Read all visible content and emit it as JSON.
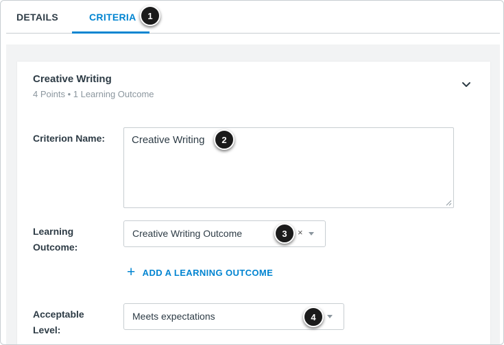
{
  "tabs": {
    "details": "DETAILS",
    "criteria": "CRITERIA"
  },
  "callouts": [
    "1",
    "2",
    "3",
    "4"
  ],
  "card": {
    "title": "Creative Writing",
    "subtitle": "4 Points • 1 Learning Outcome"
  },
  "form": {
    "criterion_name_label": "Criterion Name:",
    "criterion_name_value": "Creative Writing",
    "learning_outcome_label_1": "Learning",
    "learning_outcome_label_2": "Outcome:",
    "learning_outcome_value": "Creative Writing Outcome",
    "clear_glyph": "×",
    "add_outcome_label": "ADD A LEARNING OUTCOME",
    "plus_glyph": "+",
    "acceptable_level_label_1": "Acceptable",
    "acceptable_level_label_2": "Level:",
    "acceptable_level_value": "Meets expectations"
  },
  "icons": {
    "collapse": "chevron-down-icon",
    "dropdown": "caret-down-icon",
    "clear": "close-icon",
    "add": "plus-icon"
  },
  "colors": {
    "accent": "#0084d1",
    "text": "#2d3b45",
    "muted": "#8b969e",
    "panel": "#f2f3f4",
    "callout": "#1b1b1b"
  }
}
